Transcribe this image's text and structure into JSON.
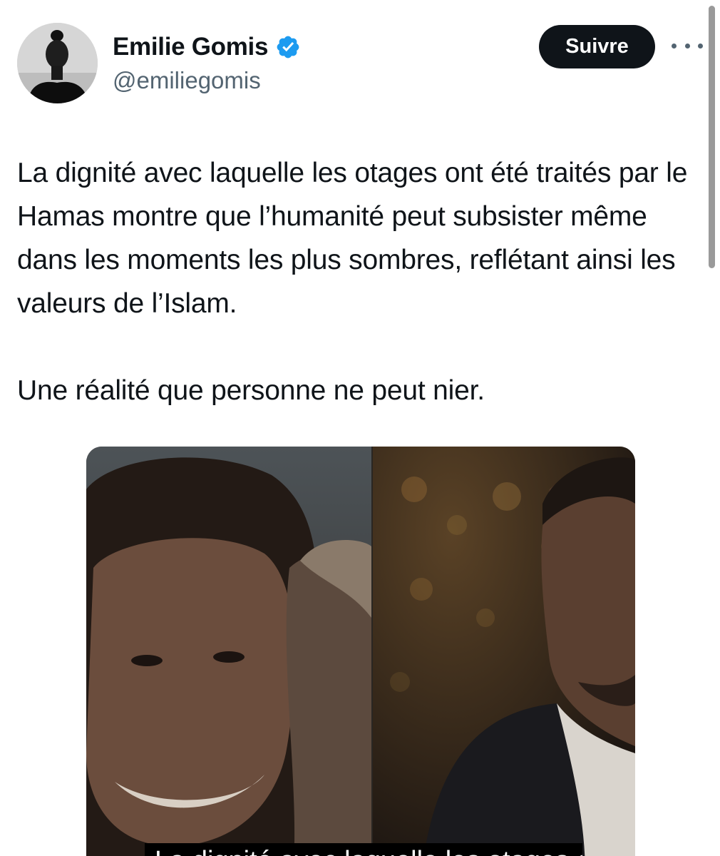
{
  "author": {
    "display_name": "Emilie Gomis",
    "handle": "@emiliegomis",
    "verified": true,
    "avatar_icon": "profile-avatar"
  },
  "actions": {
    "follow_label": "Suivre",
    "more_icon": "more-horizontal-icon"
  },
  "tweet": {
    "paragraphs": [
      "La dignité avec laquelle les otages ont été traités par le Hamas montre que l’humanité peut subsister même dans les moments les plus sombres, reflétant ainsi les valeurs de l’Islam.",
      "Une réalité que personne ne peut nier."
    ]
  },
  "media": {
    "caption": "La dignité avec laquelle les otages ont"
  },
  "colors": {
    "text": "#0f1419",
    "secondary": "#536471",
    "verified": "#1d9bf0",
    "button_bg": "#0f1419",
    "button_text": "#ffffff"
  }
}
